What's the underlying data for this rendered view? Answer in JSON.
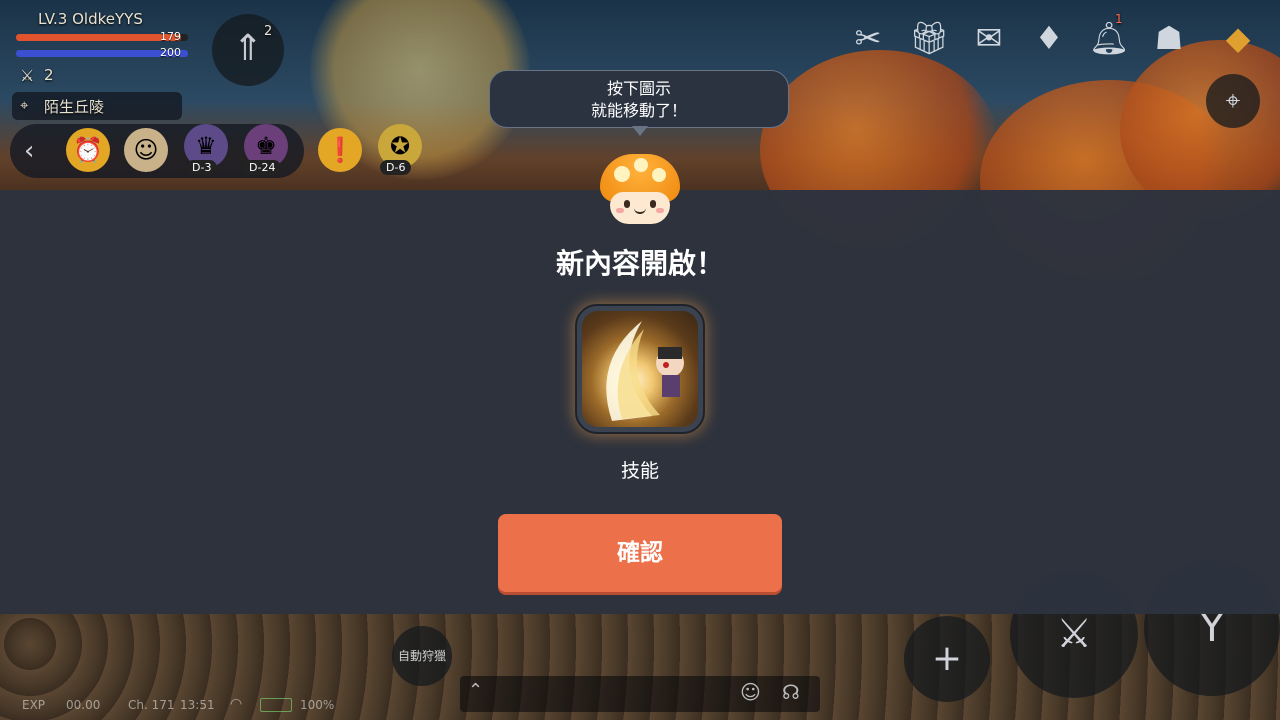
{
  "hud": {
    "player_level_name": "LV.3 OldkeYYS",
    "hp_value": "179",
    "hp_fraction": 0.96,
    "mp_value": "200",
    "mp_fraction": 1.0,
    "combat_count": "2",
    "location": "陌生丘陵",
    "power_badge": "2",
    "notification_badge": "1"
  },
  "event_bar": {
    "items": [
      {
        "label": ""
      },
      {
        "label": ""
      },
      {
        "label": "D-3"
      },
      {
        "label": "D-24"
      },
      {
        "label": ""
      },
      {
        "label": "D-6"
      }
    ]
  },
  "modal": {
    "tooltip_line1": "按下圖示",
    "tooltip_line2": "就能移動了！",
    "title": "新內容開啟！",
    "content_label": "技能",
    "confirm_label": "確認"
  },
  "bottom": {
    "auto_button": "自動狩獵",
    "status_exp": "EXP",
    "status_exp_value": "00.00",
    "status_channel": "Ch. 171",
    "status_time": "13:51",
    "status_battery": "100%"
  },
  "colors": {
    "accent": "#ec704a",
    "panel": "#2c333e",
    "hp": "#e0532d",
    "mp": "#3a4fd1"
  }
}
